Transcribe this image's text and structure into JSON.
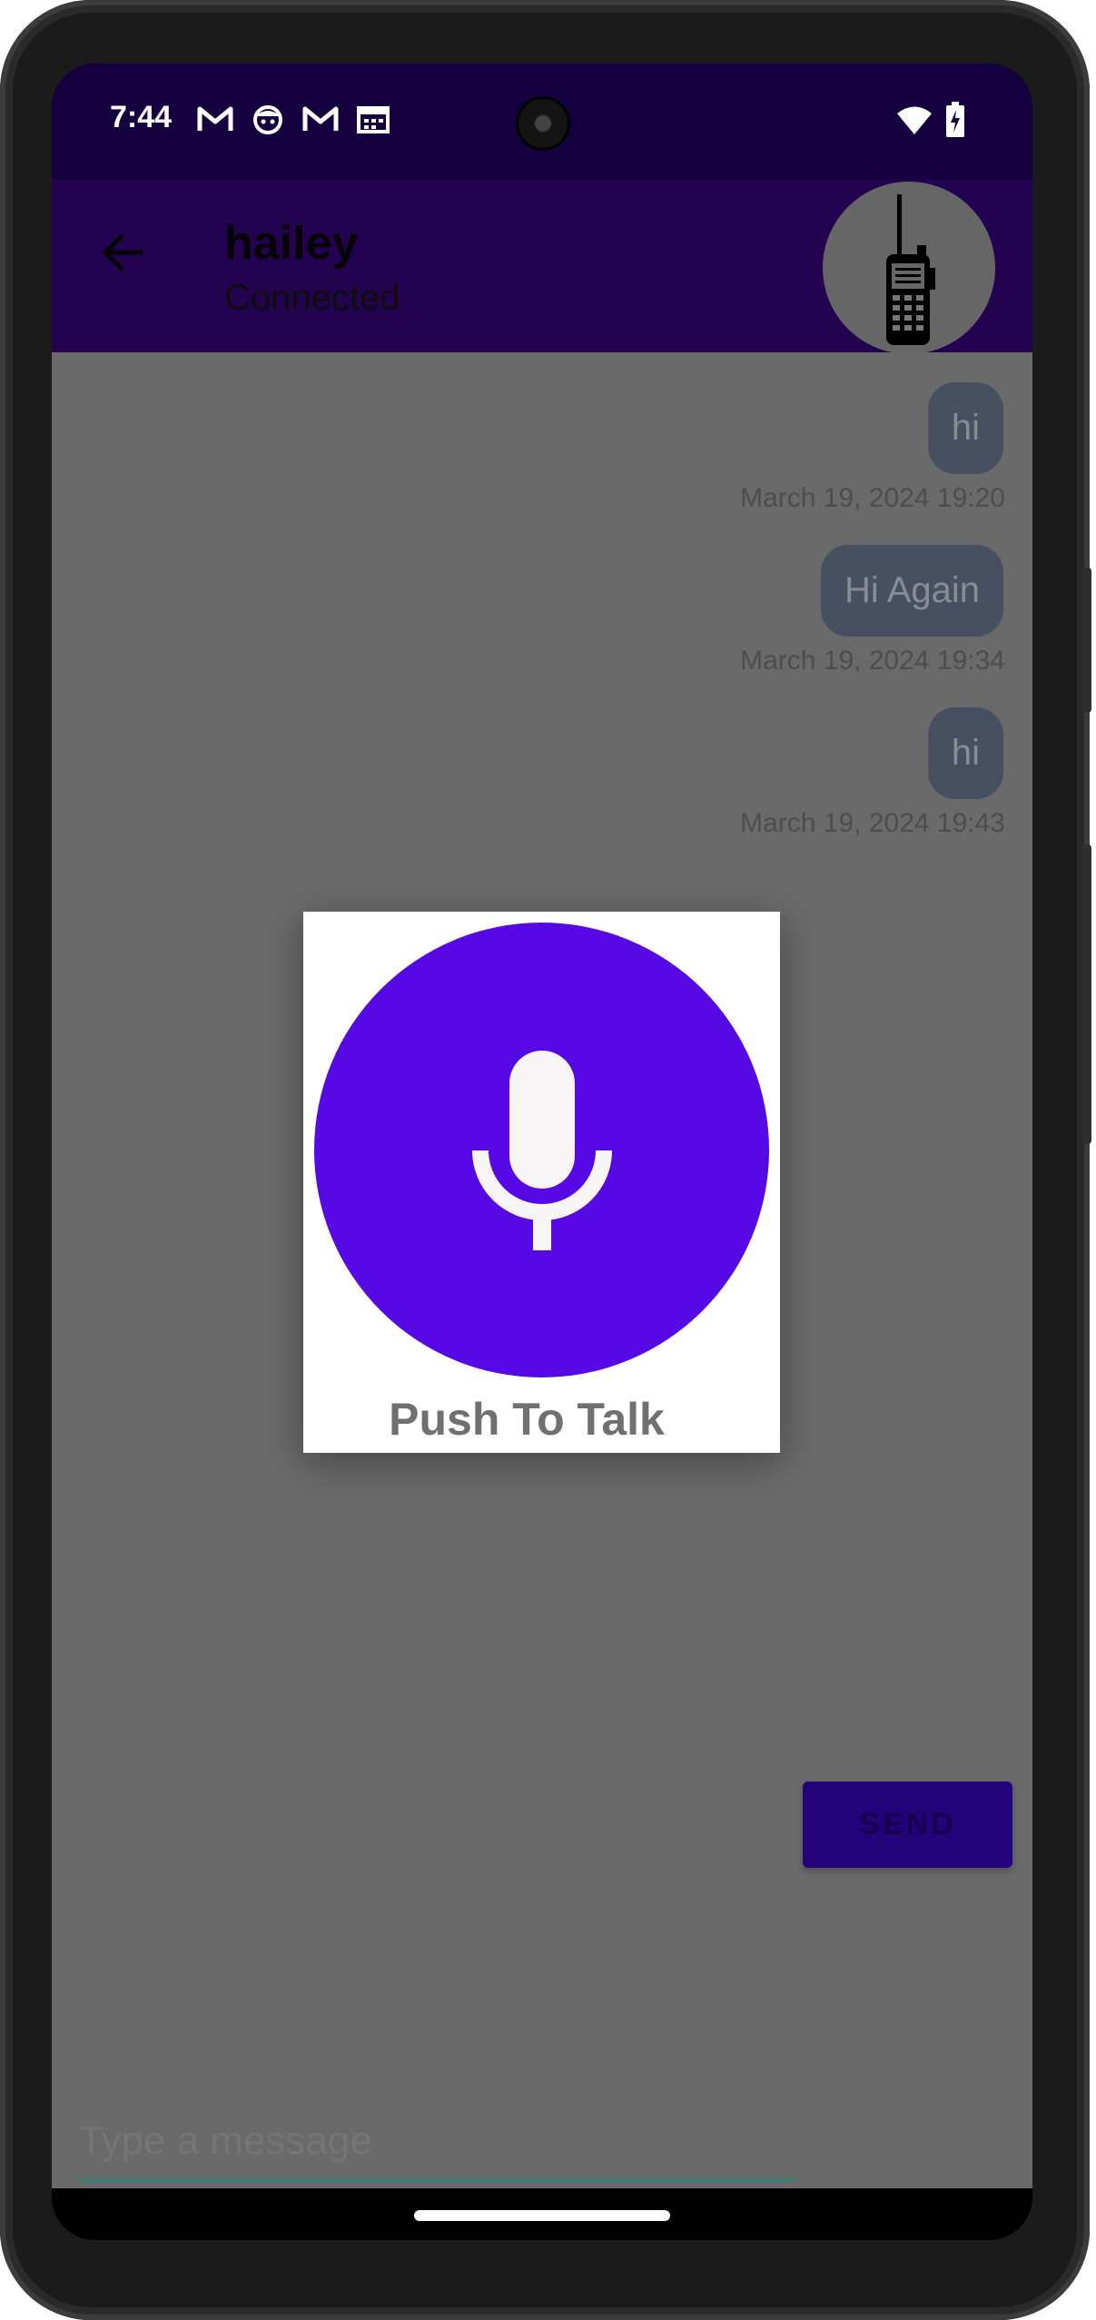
{
  "status_bar": {
    "time": "7:44",
    "notification_icons": [
      "gmail-icon",
      "app-face-icon",
      "gmail-icon",
      "calendar-icon"
    ],
    "right_icons": [
      "wifi-icon",
      "battery-charging-icon"
    ]
  },
  "app_bar": {
    "title": "hailey",
    "subtitle": "Connected",
    "avatar_icon": "walkie-talkie-icon"
  },
  "messages": [
    {
      "text": "hi",
      "timestamp": "March 19, 2024 19:20"
    },
    {
      "text": "Hi Again",
      "timestamp": "March 19, 2024 19:34"
    },
    {
      "text": "hi",
      "timestamp": "March 19, 2024 19:43"
    }
  ],
  "dialog": {
    "label": "Push To Talk",
    "icon": "microphone-icon"
  },
  "composer": {
    "placeholder": "Type a message",
    "send_label": "SEND"
  },
  "colors": {
    "status_bar": "#14003e",
    "app_bar": "#23034f",
    "mic_button": "#5609e5",
    "send_button": "#23037a",
    "overlay": "#6a6a6a"
  }
}
